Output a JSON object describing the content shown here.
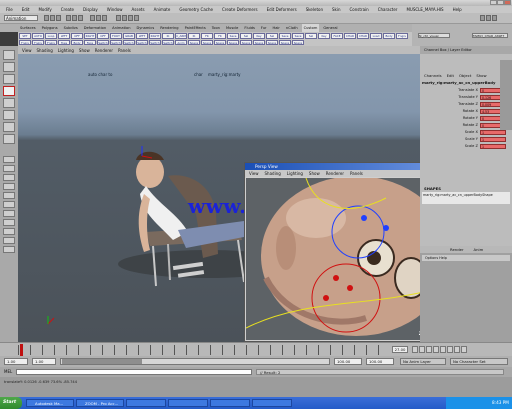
{
  "menubar": {
    "items": [
      "File",
      "Edit",
      "Modify",
      "Create",
      "Display",
      "Window",
      "Assets",
      "Animate",
      "Geometry Cache",
      "Create Deformers",
      "Edit Deformers",
      "Skeleton",
      "Skin",
      "Constrain",
      "Character",
      "MUSCLE_MAYA.HIS",
      "Help"
    ]
  },
  "statusline": {
    "mode": "Animation"
  },
  "shelf": {
    "tabs": [
      "Surfaces",
      "Polygons",
      "Subdivs",
      "Deformation",
      "Animation",
      "Dynamics",
      "Rendering",
      "PaintEffects",
      "Toon",
      "Muscle",
      "Fluids",
      "Fur",
      "Hair",
      "nCloth",
      "Custom",
      "General"
    ],
    "active_tab": "Custom",
    "buttons": [
      "SET",
      "AUTO",
      "Loop",
      "LEFT",
      "OFF",
      "RIGHT",
      "OFF",
      "FOOT",
      "GRAB",
      "LEFT",
      "RIGHT",
      "IK",
      "C_ARM",
      "IK",
      "FK",
      "FK",
      "Save",
      "Sel",
      "Key",
      "Sel",
      "Save",
      "Save",
      "Sel",
      "Key",
      "FACE",
      "CHAR",
      "CHAR",
      "Load",
      "Body",
      "Fngrs",
      "Fngrs",
      "Fngrs",
      "Fngrs",
      "Toes",
      "Body",
      "Face",
      "Switch",
      "Switch",
      "Switch",
      "Switch",
      "Switch",
      "Switch",
      "Anim",
      "Space",
      "Space",
      "Space",
      "Space",
      "Space",
      "Space",
      "Space",
      "Space",
      "Space"
    ],
    "right_fields": [
      "fk_ctrl_visual",
      "FAMILY_CHAR_ASSET"
    ]
  },
  "viewport": {
    "menu": [
      "View",
      "Shading",
      "Lighting",
      "Show",
      "Renderer",
      "Panels"
    ],
    "overlay_left": "auto char to",
    "overlay_center": "char",
    "overlay_obj": "marty_rig:marty"
  },
  "persp": {
    "title": "Persp View",
    "menu": [
      "View",
      "Shading",
      "Lighting",
      "Show",
      "Renderer",
      "Panels"
    ],
    "fps": "2.3 fps"
  },
  "channelbox": {
    "header": "Channel Box / Layer Editor",
    "menu": [
      "Channels",
      "Edit",
      "Object",
      "Show"
    ],
    "object": "marty_rig:marty_ac_cn_upperBody",
    "attrs": [
      {
        "name": "Translate X",
        "value": "0"
      },
      {
        "name": "Translate Y",
        "value": "0.126"
      },
      {
        "name": "Translate Z",
        "value": "0.009"
      },
      {
        "name": "Rotate X",
        "value": "4.53"
      },
      {
        "name": "Rotate Y",
        "value": "0"
      },
      {
        "name": "Rotate Z",
        "value": "0"
      },
      {
        "name": "Scale X",
        "value": "1"
      },
      {
        "name": "Scale Y",
        "value": "1"
      },
      {
        "name": "Scale Z",
        "value": "1"
      }
    ],
    "shapes_label": "SHAPES",
    "shapes_value": "marty_rig:marty_ac_cn_upperBodyShape"
  },
  "layer_editor": {
    "menu": [
      "Render",
      "Anim"
    ],
    "options": "Options   Help"
  },
  "timeline": {
    "current_frame": "27.00"
  },
  "range": {
    "start": "1.00",
    "start2": "1.00",
    "end": "100.00",
    "end2": "100.00",
    "anim_layer": "No Anim Layer",
    "char_set": "No Character Set"
  },
  "cmdline": {
    "label": "MEL",
    "result": "// Result: 2"
  },
  "helpline": {
    "text": "translateY: 0.0126   -0.639   73.6%   -85.744"
  },
  "taskbar": {
    "start": "Start",
    "tasks": [
      "Autodesk Ma...",
      "ZOOM - Pro Acc...",
      "",
      "",
      "",
      ""
    ],
    "clock": "8:43 PM"
  },
  "watermark": "www.cg-ku.com"
}
